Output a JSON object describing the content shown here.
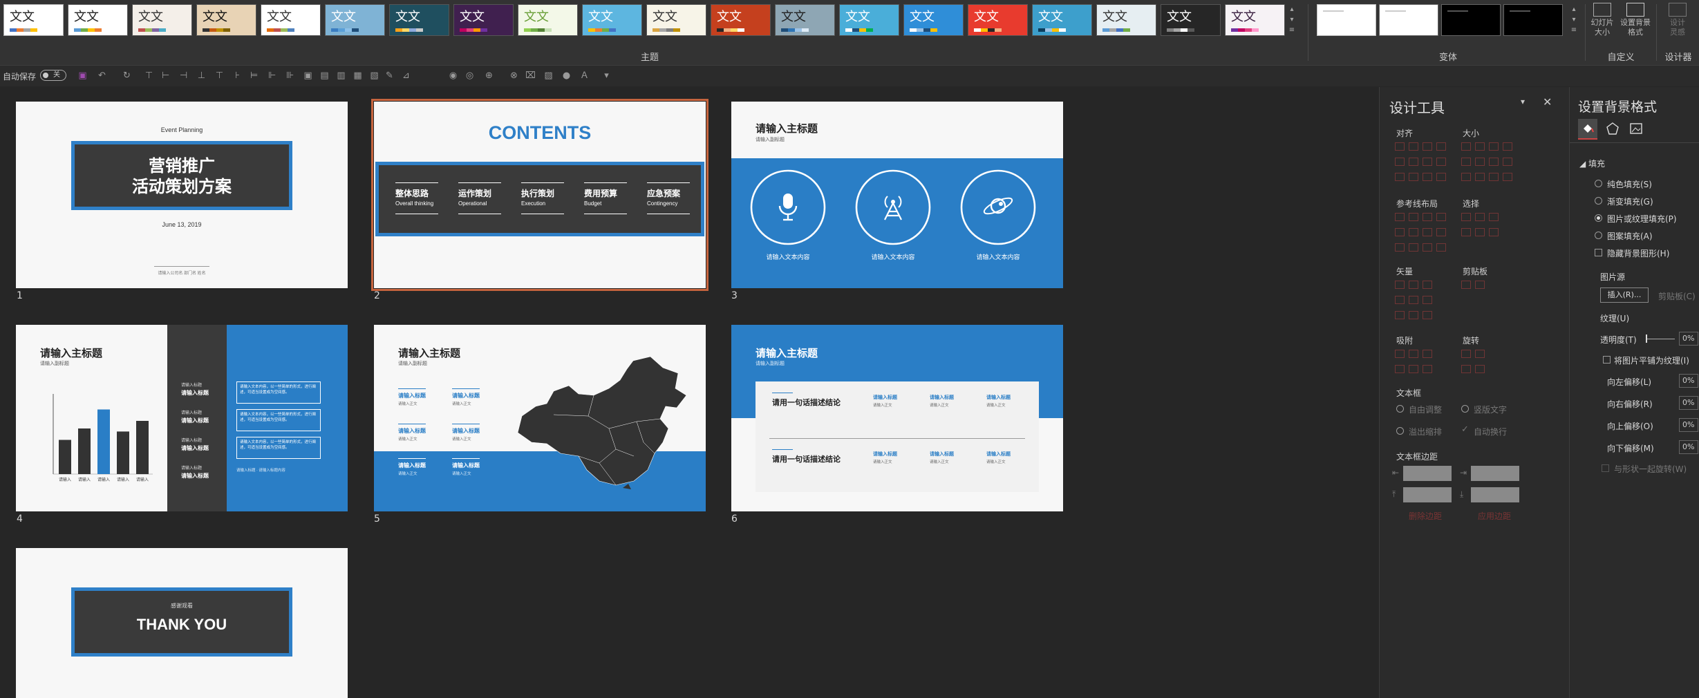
{
  "ribbon": {
    "themes": [
      {
        "text": "文文",
        "bg": "#ffffff",
        "fg": "#222222",
        "bars": [
          "#4472c4",
          "#ed7d31",
          "#a5a5a5",
          "#ffc000"
        ]
      },
      {
        "text": "文文",
        "bg": "#ffffff",
        "fg": "#222222",
        "bars": [
          "#5b9bd5",
          "#70ad47",
          "#ffc000",
          "#ed7d31"
        ]
      },
      {
        "text": "文文",
        "bg": "#f4efe9",
        "fg": "#333333",
        "bars": [
          "#c0504d",
          "#9bbb59",
          "#8064a2",
          "#4bacc6"
        ]
      },
      {
        "text": "文文",
        "bg": "#e8d3b5",
        "fg": "#111111",
        "bars": [
          "#333333",
          "#c55a11",
          "#bf9000",
          "#7f6000"
        ]
      },
      {
        "text": "文文",
        "bg": "#ffffff",
        "fg": "#333333",
        "bars": [
          "#e46c0a",
          "#c0504d",
          "#9bbb59",
          "#4f81bd"
        ]
      },
      {
        "text": "文文",
        "bg": "#7fb3d5",
        "fg": "#ffffff",
        "bars": [
          "#3a7dc1",
          "#5aa0d8",
          "#8cc0e8",
          "#1f4e79"
        ]
      },
      {
        "text": "文文",
        "bg": "#1f4f5f",
        "fg": "#ffffff",
        "bars": [
          "#f9a11b",
          "#ffd966",
          "#8faadc",
          "#c9c9c9"
        ]
      },
      {
        "text": "文文",
        "bg": "#40204f",
        "fg": "#ffffff",
        "bars": [
          "#c00060",
          "#e0407f",
          "#ff9900",
          "#7030a0"
        ]
      },
      {
        "text": "文文",
        "bg": "#f3f8e8",
        "fg": "#6aa038",
        "bars": [
          "#92d050",
          "#70ad47",
          "#548235",
          "#c5e0b4"
        ]
      },
      {
        "text": "文文",
        "bg": "#5db6e0",
        "fg": "#ffffff",
        "bars": [
          "#ffc000",
          "#ed7d31",
          "#70ad47",
          "#4472c4"
        ]
      },
      {
        "text": "文文",
        "bg": "#f7f4e8",
        "fg": "#333333",
        "bars": [
          "#d9a441",
          "#a6a6a6",
          "#7f7f7f",
          "#bf9000"
        ]
      },
      {
        "text": "文文",
        "bg": "#c5401e",
        "fg": "#ffffff",
        "bars": [
          "#262626",
          "#f4b183",
          "#ffd966",
          "#ffffff"
        ]
      },
      {
        "text": "文文",
        "bg": "#8ea6b4",
        "fg": "#222222",
        "bars": [
          "#1f4e79",
          "#2e75b6",
          "#9dc3e6",
          "#deebf7"
        ]
      },
      {
        "text": "文文",
        "bg": "#4aaed9",
        "fg": "#ffffff",
        "bars": [
          "#ffffff",
          "#1f4e79",
          "#ffc000",
          "#00b050"
        ]
      },
      {
        "text": "文文",
        "bg": "#2f8ed8",
        "fg": "#ffffff",
        "bars": [
          "#ffffff",
          "#9dc3e6",
          "#1f4e79",
          "#ffc000"
        ]
      },
      {
        "text": "文文",
        "bg": "#e83b2e",
        "fg": "#ffffff",
        "bars": [
          "#ffffff",
          "#ffc000",
          "#262626",
          "#f4b183"
        ]
      },
      {
        "text": "文文",
        "bg": "#3d9fcc",
        "fg": "#ffffff",
        "bars": [
          "#0b3d5c",
          "#9dc3e6",
          "#ffc000",
          "#ffffff"
        ]
      },
      {
        "text": "文文",
        "bg": "#e6eef2",
        "fg": "#333333",
        "bars": [
          "#5b9bd5",
          "#a5a5a5",
          "#4472c4",
          "#70ad47"
        ]
      },
      {
        "text": "文文",
        "bg": "#262626",
        "fg": "#ffffff",
        "bars": [
          "#808080",
          "#a6a6a6",
          "#ffffff",
          "#595959"
        ]
      },
      {
        "text": "文文",
        "bg": "#f6f2f5",
        "fg": "#3a2040",
        "bars": [
          "#7030a0",
          "#c00060",
          "#e0407f",
          "#ff99cc"
        ]
      }
    ],
    "theme_group_label": "主题",
    "variants": [
      {
        "bg": "#ffffff"
      },
      {
        "bg": "#ffffff"
      },
      {
        "bg": "#000000"
      },
      {
        "bg": "#000000"
      }
    ],
    "variant_group_label": "变体",
    "slide_size_label": "幻灯片大小",
    "format_bg_label": "设置背景格式",
    "custom_group_label": "自定义",
    "design_idea_label": "设计灵感",
    "designer_group_label": "设计器"
  },
  "qat": {
    "autosave_label": "自动保存",
    "autosave_state": "关"
  },
  "slides": [
    {
      "number": "1",
      "small_title": "Event Planning",
      "main_title_1": "营销推广",
      "main_title_2": "活动策划方案",
      "date": "June 13, 2019",
      "footer": "请输入公司名  部门名 姓名"
    },
    {
      "number": "2",
      "title": "CONTENTS",
      "items": [
        {
          "cn": "整体思路",
          "en": "Overall thinking"
        },
        {
          "cn": "运作策划",
          "en": "Operational"
        },
        {
          "cn": "执行策划",
          "en": "Execution"
        },
        {
          "cn": "费用预算",
          "en": "Budget"
        },
        {
          "cn": "应急预案",
          "en": "Contingency"
        }
      ]
    },
    {
      "number": "3",
      "title": "请输入主标题",
      "subtitle": "请输入副标题",
      "captions": [
        "请输入文本内容",
        "请输入文本内容",
        "请输入文本内容"
      ],
      "icons": [
        "microphone-icon",
        "antenna-icon",
        "planet-icon"
      ]
    },
    {
      "number": "4",
      "title": "请输入主标题",
      "subtitle": "请输入副标题",
      "bar_values": [
        0.45,
        0.6,
        0.85,
        0.56,
        0.7
      ],
      "bar_labels": [
        "请输入",
        "请输入",
        "请输入",
        "请输入",
        "请输入"
      ],
      "mid_items": [
        {
          "sm": "请输入标题",
          "lg": "请输入标题"
        },
        {
          "sm": "请输入标题",
          "lg": "请输入标题"
        },
        {
          "sm": "请输入标题",
          "lg": "请输入标题"
        },
        {
          "sm": "请输入标题",
          "lg": "请输入标题"
        }
      ],
      "box_text": [
        "请输入文本内容，以一些简单的形式，进行阐述，可适当设置成为空间感。",
        "请输入文本内容，以一些简单的形式，进行阐述，可适当设置成为空间感。",
        "请输入文本内容，以一些简单的形式，进行阐述，可适当设置成为空间感。"
      ],
      "box_footer": "请输入标题 · 请输入标题内容"
    },
    {
      "number": "5",
      "title": "请输入主标题",
      "subtitle": "请输入副标题",
      "items": [
        {
          "t": "请输入标题",
          "s": "请输入正文"
        },
        {
          "t": "请输入标题",
          "s": "请输入正文"
        },
        {
          "t": "请输入标题",
          "s": "请输入正文"
        },
        {
          "t": "请输入标题",
          "s": "请输入正文"
        },
        {
          "t": "请输入标题",
          "s": "请输入正文"
        },
        {
          "t": "请输入标题",
          "s": "请输入正文"
        }
      ]
    },
    {
      "number": "6",
      "title": "请输入主标题",
      "subtitle": "请输入副标题",
      "rows": [
        {
          "left": "请用一句话描述结论",
          "cols": [
            {
              "t": "请输入标题",
              "s": "请输入正文"
            },
            {
              "t": "请输入标题",
              "s": "请输入正文"
            },
            {
              "t": "请输入标题",
              "s": "请输入正文"
            }
          ]
        },
        {
          "left": "请用一句话描述结论",
          "cols": [
            {
              "t": "请输入标题",
              "s": "请输入正文"
            },
            {
              "t": "请输入标题",
              "s": "请输入正文"
            },
            {
              "t": "请输入标题",
              "s": "请输入正文"
            }
          ]
        }
      ]
    },
    {
      "number": "7",
      "small": "感谢观看",
      "big": "THANK YOU"
    }
  ],
  "design_panel": {
    "title": "设计工具",
    "sections": {
      "align": "对齐",
      "size": "大小",
      "guides": "参考线布局",
      "select": "选择",
      "vector": "矢量",
      "clipboard": "剪贴板",
      "snap": "吸附",
      "rotate": "旋转",
      "textbox": "文本框",
      "textbox_margin": "文本框边距"
    },
    "textbox_options": {
      "auto_adjust": "自由调整",
      "vertical": "竖版文字",
      "overflow": "溢出缩排",
      "autowrap": "自动换行"
    },
    "margin_buttons": {
      "delete": "删除边距",
      "apply": "应用边距"
    }
  },
  "bg_panel": {
    "title": "设置背景格式",
    "fill_label": "填充",
    "fill_options": [
      {
        "label": "纯色填充(S)",
        "checked": false
      },
      {
        "label": "渐变填充(G)",
        "checked": false
      },
      {
        "label": "图片或纹理填充(P)",
        "checked": true
      },
      {
        "label": "图案填充(A)",
        "checked": false
      }
    ],
    "hide_bg": "隐藏背景图形(H)",
    "picture_source": "图片源",
    "insert_btn": "插入(R)...",
    "clipboard_btn": "剪贴板(C)",
    "texture": "纹理(U)",
    "transparency_label": "透明度(T)",
    "transparency_value": "0%",
    "tile_label": "将图片平铺为纹理(I)",
    "offsets": [
      {
        "label": "向左偏移(L)",
        "value": "0%"
      },
      {
        "label": "向右偏移(R)",
        "value": "0%"
      },
      {
        "label": "向上偏移(O)",
        "value": "0%"
      },
      {
        "label": "向下偏移(M)",
        "value": "0%"
      }
    ],
    "rotate_with_shape": "与形状一起旋转(W)"
  }
}
